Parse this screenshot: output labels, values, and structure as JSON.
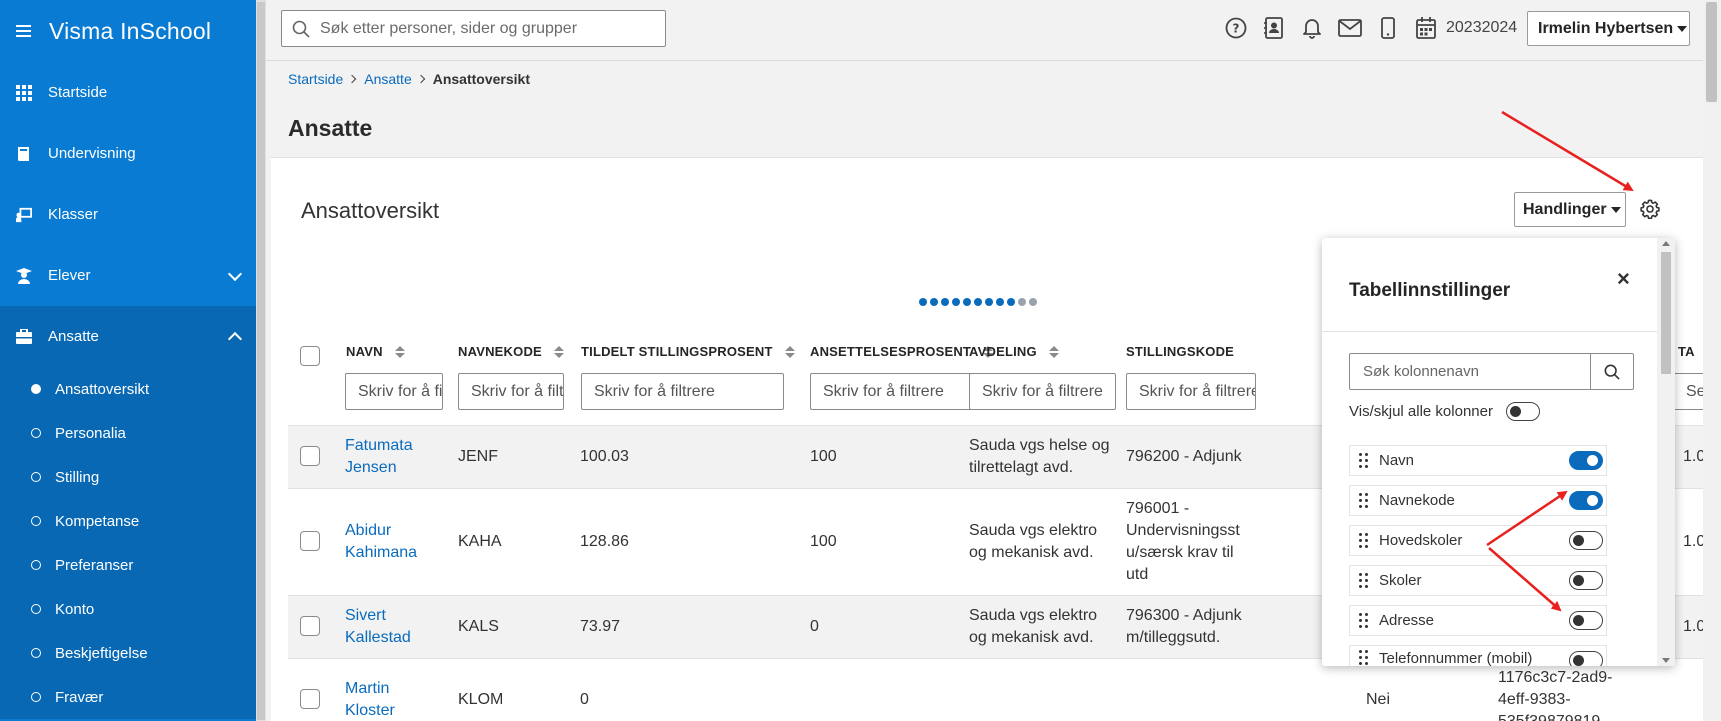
{
  "app": {
    "title": "Visma InSchool"
  },
  "sidebar": {
    "items": [
      {
        "label": "Startside"
      },
      {
        "label": "Undervisning"
      },
      {
        "label": "Klasser"
      },
      {
        "label": "Elever"
      },
      {
        "label": "Ansatte"
      }
    ],
    "sub_items": [
      {
        "label": "Ansattoversikt"
      },
      {
        "label": "Personalia"
      },
      {
        "label": "Stilling"
      },
      {
        "label": "Kompetanse"
      },
      {
        "label": "Preferanser"
      },
      {
        "label": "Konto"
      },
      {
        "label": "Beskjeftigelse"
      },
      {
        "label": "Fravær"
      }
    ]
  },
  "topbar": {
    "search_placeholder": "Søk etter personer, sider og grupper",
    "year": "20232024",
    "user": "Irmelin Hybertsen"
  },
  "breadcrumb": {
    "items": [
      "Startside",
      "Ansatte"
    ],
    "current": "Ansattoversikt"
  },
  "page": {
    "title": "Ansatte",
    "panel_title": "Ansattoversikt",
    "actions_label": "Handlinger"
  },
  "table": {
    "columns": [
      "NAVN",
      "NAVNEKODE",
      "TILDELT STILLINGSPROSENT",
      "ANSETTELSESPROSENT",
      "AVDELING",
      "STILLINGSKODE"
    ],
    "filter_placeholder": "Skriv for å filtrere",
    "rows": [
      {
        "name_1": "Fatumata",
        "name_2": "Jensen",
        "code": "JENF",
        "tildelt": "100.03",
        "ansettelse": "100",
        "avd_1": "Sauda vgs helse og",
        "avd_2": "tilrettelagt avd.",
        "stilling_1": "796200 - Adjunk",
        "stilling_2": "",
        "stilling_3": "",
        "stilling_4": "",
        "extra": ""
      },
      {
        "name_1": "Abidur",
        "name_2": "Kahimana",
        "code": "KAHA",
        "tildelt": "128.86",
        "ansettelse": "100",
        "avd_1": "Sauda vgs elektro",
        "avd_2": "og mekanisk avd.",
        "stilling_1": "796001 -",
        "stilling_2": "Undervisningsst",
        "stilling_3": "u/særsk krav til",
        "stilling_4": "utd",
        "extra": ""
      },
      {
        "name_1": "Sivert",
        "name_2": "Kallestad",
        "code": "KALS",
        "tildelt": "73.97",
        "ansettelse": "0",
        "avd_1": "Sauda vgs elektro",
        "avd_2": "og mekanisk avd.",
        "stilling_1": "796300 - Adjunk",
        "stilling_2": "m/tilleggsutd.",
        "stilling_3": "",
        "stilling_4": "",
        "extra": ""
      },
      {
        "name_1": "Martin",
        "name_2": "Kloster",
        "code": "KLOM",
        "tildelt": "0",
        "ansettelse": "",
        "avd_1": "",
        "avd_2": "",
        "stilling_1": "",
        "stilling_2": "",
        "stilling_3": "",
        "stilling_4": "",
        "extra": "Nei"
      }
    ],
    "peek_values": [
      "1.0",
      "1.0",
      "1.0"
    ],
    "peek_header": "TA",
    "peek_filter": "Se",
    "guid_lines": [
      "1176c3c7-2ad9-",
      "4eff-9383-",
      "535f39879819"
    ]
  },
  "settings": {
    "title": "Tabellinnstillinger",
    "close": "×",
    "search_placeholder": "Søk kolonnenavn",
    "toggle_all_label": "Vis/skjul alle kolonner",
    "columns": [
      {
        "label": "Navn",
        "on": true
      },
      {
        "label": "Navnekode",
        "on": true
      },
      {
        "label": "Hovedskoler",
        "on": false
      },
      {
        "label": "Skoler",
        "on": false
      },
      {
        "label": "Adresse",
        "on": false
      },
      {
        "label": "Telefonnummer (mobil)",
        "on": false
      }
    ]
  },
  "colors": {
    "brand": "#0a7bd2",
    "link": "#0a6bbd",
    "annotation": "#e8201e"
  }
}
